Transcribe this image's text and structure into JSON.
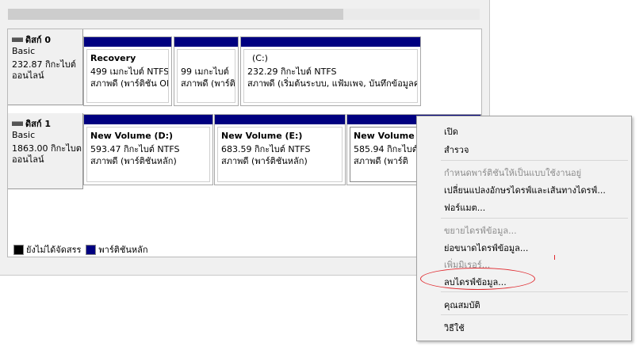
{
  "disks": [
    {
      "title": "ดิสก์ 0",
      "type": "Basic",
      "size": "232.87 กิกะไบต์",
      "status": "ออนไลน์",
      "partitions": [
        {
          "name": "Recovery",
          "size": "499 เมกะไบต์ NTFS",
          "status": "สภาพดี (พาร์ติชัน OE"
        },
        {
          "name": "",
          "size": "99 เมกะไบต์",
          "status": "สภาพดี (พาร์ติง"
        },
        {
          "name": "(C:)",
          "size": "232.29 กิกะไบต์ NTFS",
          "status": "สภาพดี (เริ่มต้นระบบ, แฟ้มเพจ, บันทึกข้อมูลควา"
        }
      ]
    },
    {
      "title": "ดิสก์ 1",
      "type": "Basic",
      "size": "1863.00 กิกะไบต",
      "status": "ออนไลน์",
      "partitions": [
        {
          "name": "New Volume  (D:)",
          "size": "593.47 กิกะไบต์ NTFS",
          "status": "สภาพดี (พาร์ติชันหลัก)"
        },
        {
          "name": "New Volume  (E:)",
          "size": "683.59 กิกะไบต์ NTFS",
          "status": "สภาพดี (พาร์ติชันหลัก)"
        },
        {
          "name": "New Volume  (",
          "size": "585.94 กิกะไบต์",
          "status": "สภาพดี (พาร์ติ"
        }
      ]
    }
  ],
  "legend": [
    {
      "label": "ยังไม่ได้จัดสรร",
      "color": "#000000"
    },
    {
      "label": "พาร์ติชันหลัก",
      "color": "#000080"
    }
  ],
  "context_menu": [
    {
      "label": "เปิด",
      "disabled": false
    },
    {
      "label": "สำรวจ",
      "disabled": false
    },
    {
      "label": "กำหนดพาร์ติชันให้เป็นแบบใช้งานอยู่",
      "disabled": true
    },
    {
      "label": "เปลี่ยนแปลงอักษรไดรฟ์และเส้นทางไดรฟ์...",
      "disabled": false
    },
    {
      "label": "ฟอร์แมต...",
      "disabled": false
    },
    {
      "label": "ขยายไดรฟ์ข้อมูล...",
      "disabled": true
    },
    {
      "label": "ย่อขนาดไดรฟ์ข้อมูล...",
      "disabled": false
    },
    {
      "label": "เพิ่มมิเรอร์...",
      "disabled": true
    },
    {
      "label": "ลบไดรฟ์ข้อมูล...",
      "disabled": false,
      "highlighted": true
    },
    {
      "label": "คุณสมบัติ",
      "disabled": false
    },
    {
      "label": "วิธีใช้",
      "disabled": false
    }
  ],
  "colors": {
    "partition_bar": "#000080",
    "highlight_annotation": "#e0292e"
  }
}
